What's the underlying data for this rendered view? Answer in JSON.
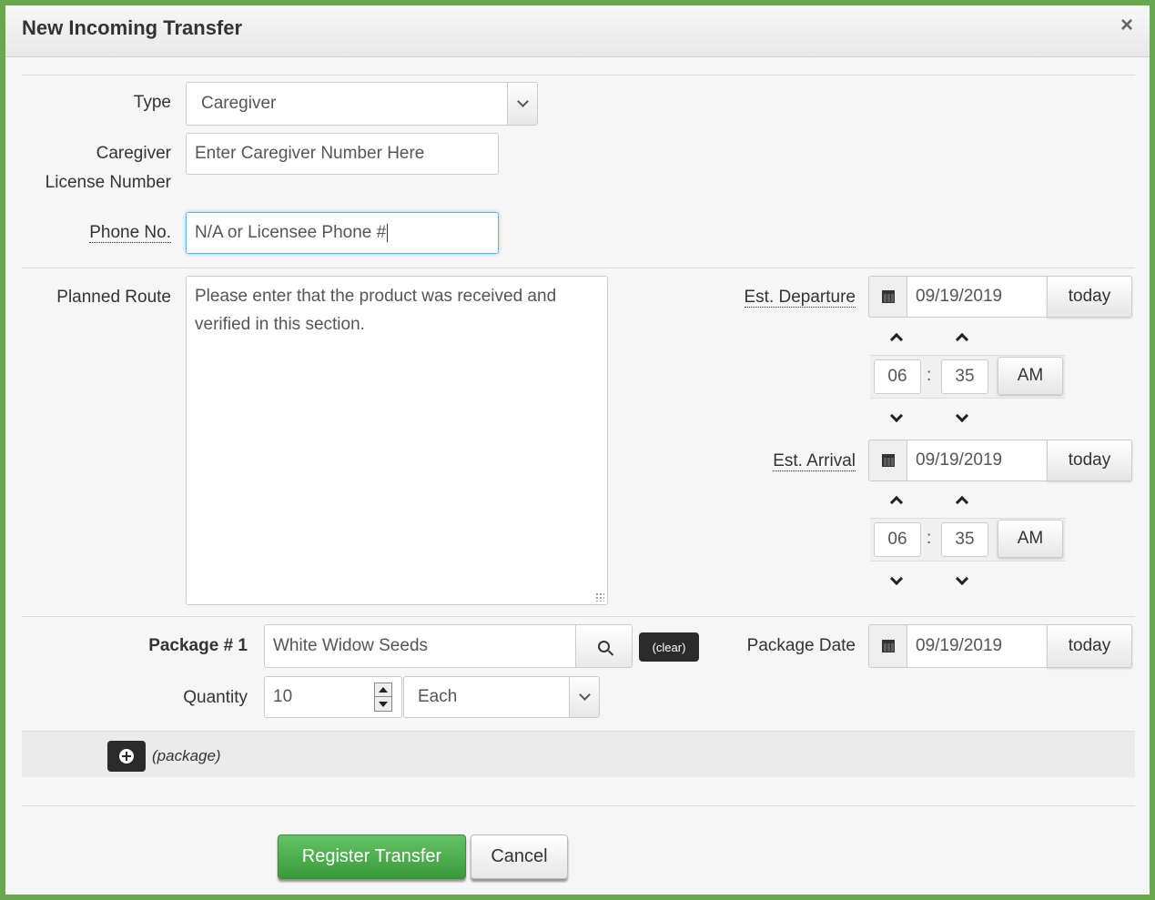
{
  "dialog": {
    "title": "New Incoming Transfer",
    "close_label": "×"
  },
  "form": {
    "type": {
      "label": "Type",
      "value": "Caregiver"
    },
    "license": {
      "label_line1": "Caregiver",
      "label_line2": "License Number",
      "value": "Enter Caregiver Number Here"
    },
    "phone": {
      "label": "Phone No.",
      "value": "N/A or Licensee Phone #"
    },
    "route": {
      "label": "Planned Route",
      "value": "Please enter that the product was received and verified in this section."
    },
    "departure": {
      "label": "Est. Departure",
      "date": "09/19/2019",
      "today_label": "today",
      "hour": "06",
      "minute": "35",
      "ampm": "AM",
      "separator": ":"
    },
    "arrival": {
      "label": "Est. Arrival",
      "date": "09/19/2019",
      "today_label": "today",
      "hour": "06",
      "minute": "35",
      "ampm": "AM",
      "separator": ":"
    },
    "package": {
      "label": "Package # 1",
      "value": "White Widow Seeds",
      "clear_label": "(clear)",
      "date_label": "Package Date",
      "date": "09/19/2019",
      "today_label": "today",
      "quantity_label": "Quantity",
      "quantity": "10",
      "unit": "Each"
    },
    "add_package_label": "(package)"
  },
  "footer": {
    "register_label": "Register Transfer",
    "cancel_label": "Cancel"
  },
  "colors": {
    "frame": "#6aa84f",
    "register_button": "#4cae4c",
    "focus": "#66afe9"
  }
}
